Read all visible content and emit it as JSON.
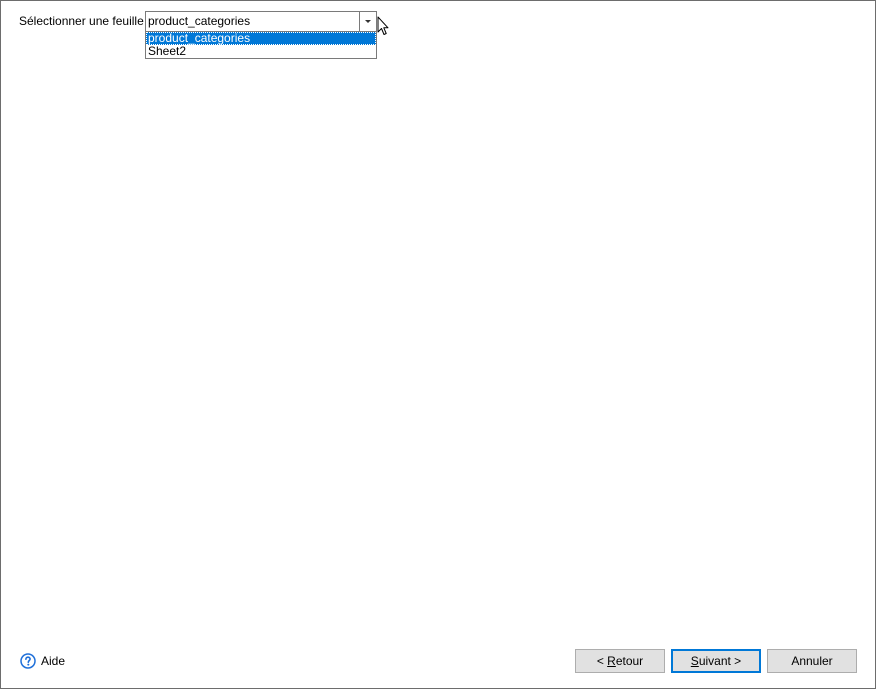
{
  "sheet_selector": {
    "label": "Sélectionner une feuille",
    "selected_value": "product_categories",
    "options": [
      {
        "label": "product_categories",
        "selected": true
      },
      {
        "label": "Sheet2",
        "selected": false
      }
    ]
  },
  "help": {
    "label": "Aide",
    "icon": "help-circle-icon",
    "icon_color": "#1e6fd9"
  },
  "buttons": {
    "back": {
      "prefix": "< ",
      "mnemonic": "R",
      "rest": "etour"
    },
    "next": {
      "mnemonic": "S",
      "rest": "uivant >"
    },
    "cancel": {
      "label": "Annuler"
    }
  },
  "colors": {
    "selection_highlight": "#0078d7",
    "default_button_border": "#0078d7"
  }
}
